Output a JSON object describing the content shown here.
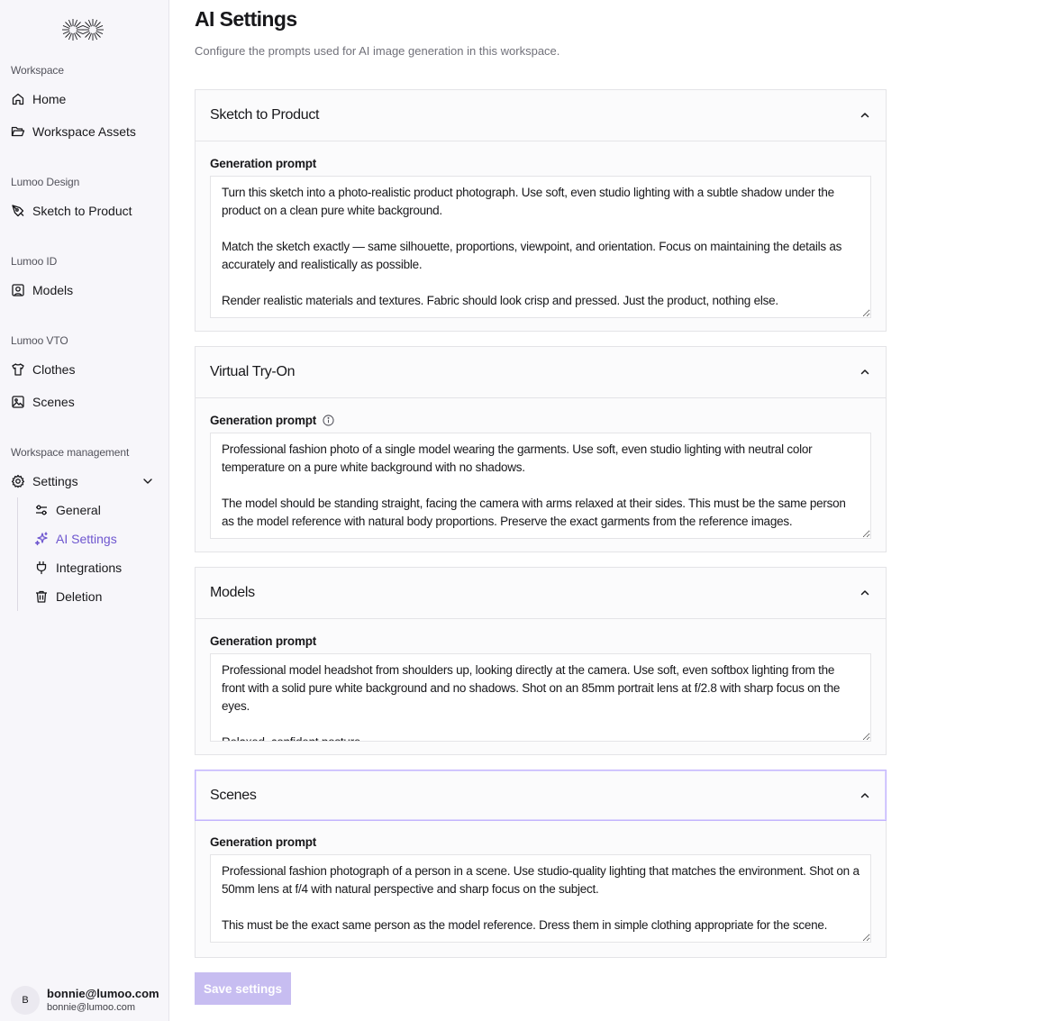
{
  "sidebar": {
    "sections": {
      "workspace": "Workspace",
      "design": "Lumoo Design",
      "id": "Lumoo ID",
      "vto": "Lumoo VTO",
      "management": "Workspace management"
    },
    "items": {
      "home": "Home",
      "assets": "Workspace Assets",
      "sketch": "Sketch to Product",
      "models": "Models",
      "clothes": "Clothes",
      "scenes": "Scenes",
      "settings": "Settings"
    },
    "settings_sub": {
      "general": "General",
      "ai": "AI Settings",
      "integrations": "Integrations",
      "deletion": "Deletion"
    },
    "user": {
      "initial": "B",
      "name": "bonnie@lumoo.com",
      "email": "bonnie@lumoo.com"
    }
  },
  "page": {
    "title": "AI Settings",
    "subtitle": "Configure the prompts used for AI image generation in this workspace."
  },
  "cards": {
    "sketch": {
      "title": "Sketch to Product",
      "label": "Generation prompt",
      "prompt": "Turn this sketch into a photo-realistic product photograph. Use soft, even studio lighting with a subtle shadow under the product on a clean pure white background.\n\nMatch the sketch exactly — same silhouette, proportions, viewpoint, and orientation. Focus on maintaining the details as accurately and realistically as possible.\n\nRender realistic materials and textures. Fabric should look crisp and pressed. Just the product, nothing else."
    },
    "vto": {
      "title": "Virtual Try-On",
      "label": "Generation prompt",
      "prompt": "Professional fashion photo of a single model wearing the garments. Use soft, even studio lighting with neutral color temperature on a pure white background with no shadows.\n\nThe model should be standing straight, facing the camera with arms relaxed at their sides. This must be the same person as the model reference with natural body proportions. Preserve the exact garments from the reference images."
    },
    "models": {
      "title": "Models",
      "label": "Generation prompt",
      "prompt": "Professional model headshot from shoulders up, looking directly at the camera. Use soft, even softbox lighting from the front with a solid pure white background and no shadows. Shot on an 85mm portrait lens at f/2.8 with sharp focus on the eyes.\n\nRelaxed, confident posture."
    },
    "scenes": {
      "title": "Scenes",
      "label": "Generation prompt",
      "prompt": "Professional fashion photograph of a person in a scene. Use studio-quality lighting that matches the environment. Shot on a 50mm lens at f/4 with natural perspective and sharp focus on the subject.\n\nThis must be the exact same person as the model reference. Dress them in simple clothing appropriate for the scene."
    }
  },
  "actions": {
    "save": "Save settings"
  },
  "colors": {
    "accent": "#6e56cf",
    "save_disabled": "#c7bdf1"
  }
}
